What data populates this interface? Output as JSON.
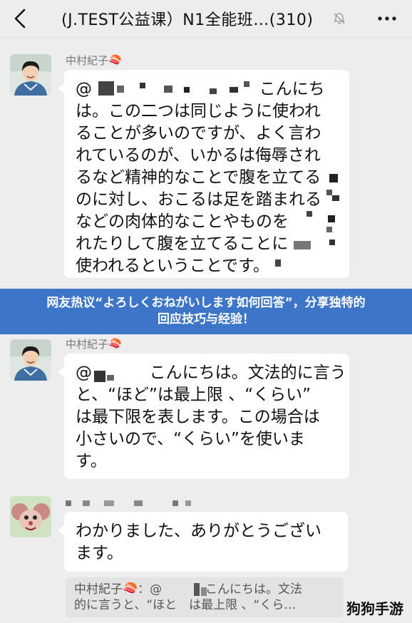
{
  "header": {
    "title": "(J.TEST公益课）N1全能班…(310)",
    "back_icon": "back-chevron-icon",
    "mute_icon": "bell-off-icon",
    "more_icon": "more-dots-icon"
  },
  "messages": [
    {
      "sender": "中村紀子🍣",
      "lines": [
        "@",
        "は。この二つは同じように使われ",
        "ることが多いのですが、よく言わ",
        "れているのが、いかるは侮辱され",
        "るなど精神的なことで腹を立てる",
        "のに対し、おこるは足を踏まれる",
        "などの肉体的なことやものを",
        "れたりして腹を立てることに",
        "使われるということです。"
      ],
      "greeting": "こんにち"
    },
    {
      "sender": "中村紀子🍣",
      "lines": [
        "@",
        "と、“ほど”は最上限 、“くらい”",
        "は最下限を表します。この場合は",
        "小さいので、“くらい”を使いま",
        "す。"
      ],
      "greeting": "こんにちは。文法的に言う"
    },
    {
      "sender": "",
      "lines": [
        "わかりました、ありがとうござい",
        "ます。"
      ]
    }
  ],
  "banner": {
    "line1": "网友热议“よろしくおねがいします如何回答”，分享独特的",
    "line2": "回应技巧与经验！"
  },
  "quote": {
    "line1_prefix": "中村紀子🍣：@",
    "line1_suffix": "こんにちは。文法",
    "line2": "的に言うと、“ほと　は最上限 、“くら…"
  },
  "watermark": "狗狗手游",
  "colors": {
    "background": "#ededed",
    "bubble": "#ffffff",
    "banner": "#3d76c8",
    "quote_bg": "#e3e3e3"
  }
}
